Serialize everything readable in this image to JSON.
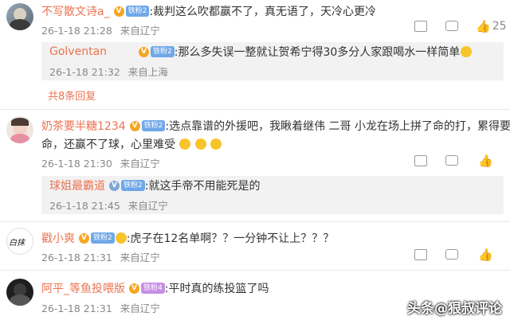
{
  "comments": [
    {
      "user": "不写散文诗a_",
      "fan_level": "铁粉2",
      "text": ":裁判这么吹都赢不了，真无语了，天冷心更冷",
      "time": "26-1-18 21:28",
      "location": "来自辽宁",
      "likes": "25",
      "replies": [
        {
          "user": "Golventan",
          "fan_level": "铁粉2",
          "text": ":那么多失误一整就让贺希宁得30多分人家跟喝水一样简单",
          "time": "26-1-18 21:32",
          "location": "来自上海"
        }
      ],
      "expand_label": "共8条回复"
    },
    {
      "user": "奶茶要半糖1234",
      "fan_level": "铁粉2",
      "text_line1": ":选点靠谱的外援吧，我瞅着继伟 二哥 小龙在场上拼了命的打，累得要",
      "text_line2": "命，还赢不了球，心里难受",
      "time": "26-1-18 21:30",
      "location": "来自辽宁",
      "replies": [
        {
          "user": "球姐最霸道",
          "fan_level": "铁粉2",
          "text": ":就这手帝不用能死是的",
          "time": "26-1-18 21:45",
          "location": "来自辽宁"
        }
      ]
    },
    {
      "user": "戳小爽",
      "fan_level": "铁粉2",
      "text": ":虎子在12名单啊？？一分钟不让上？？？",
      "time": "26-1-18 21:31",
      "location": "来自辽宁",
      "avatar_text": "白抹"
    },
    {
      "user": "阿平_等鱼投喂版",
      "fan_level": "铁粉4",
      "text": ":平时真的练投篮了吗",
      "time": "26-1-18 21:31",
      "location": "来自辽宁"
    }
  ],
  "watermark": "头条@狠叔评论",
  "colors": {
    "username": "#eb7350",
    "meta": "#888888",
    "reply_bg": "#f2f2f2"
  }
}
